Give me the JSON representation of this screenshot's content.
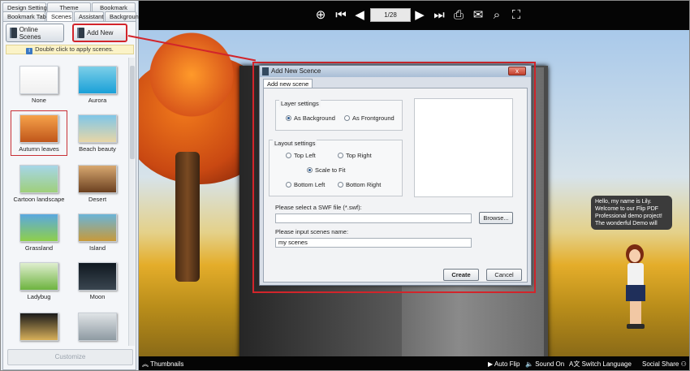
{
  "panel_tabs_row1": [
    "Design Setting",
    "Theme",
    "Bookmark"
  ],
  "panel_tabs_row2": [
    "Bookmark Tabs",
    "Scenes",
    "Assistant",
    "Background"
  ],
  "buttons": {
    "online_scenes": "Online Scenes",
    "add_new": "Add New",
    "customize": "Customize"
  },
  "hint": "Double click to apply scenes.",
  "scenes": [
    {
      "label": "None",
      "colors": [
        "#ffffff",
        "#f0f0f0"
      ]
    },
    {
      "label": "Aurora",
      "colors": [
        "#7ccfe8",
        "#1aa0d8"
      ]
    },
    {
      "label": "Autumn leaves",
      "colors": [
        "#f6a24a",
        "#c0561a"
      ],
      "selected": true
    },
    {
      "label": "Beach beauty",
      "colors": [
        "#7fc6e8",
        "#e8d6a6"
      ]
    },
    {
      "label": "Cartoon landscape",
      "colors": [
        "#a6d6e8",
        "#9fcf7a"
      ]
    },
    {
      "label": "Desert",
      "colors": [
        "#d8a870",
        "#6b4020"
      ]
    },
    {
      "label": "Grassland",
      "colors": [
        "#5aa8e0",
        "#8fcf4a"
      ]
    },
    {
      "label": "Island",
      "colors": [
        "#6ab4d8",
        "#c89a3a"
      ]
    },
    {
      "label": "Ladybug",
      "colors": [
        "#dfeecf",
        "#6db33f"
      ]
    },
    {
      "label": "Moon",
      "colors": [
        "#101820",
        "#3a4650"
      ]
    },
    {
      "label": "",
      "colors": [
        "#1a1a1a",
        "#d8b05a"
      ]
    },
    {
      "label": "",
      "colors": [
        "#dfe3e6",
        "#8e9aa2"
      ]
    }
  ],
  "toolbar": {
    "page": "1/28"
  },
  "dialog": {
    "title": "Add New Scence",
    "close": "x",
    "tab": "Add new scene",
    "layer_settings": "Layer settings",
    "as_background": "As Background",
    "as_frontground": "As Frontground",
    "layout_settings": "Layout settings",
    "top_left": "Top Left",
    "top_right": "Top Right",
    "scale_to_fit": "Scale to Fit",
    "bottom_left": "Bottom Left",
    "bottom_right": "Bottom Right",
    "swf_label": "Please select  a  SWF file (*.swf):",
    "swf_value": "",
    "browse": "Browse...",
    "name_label": "Please input scenes name:",
    "name_value": "my scenes",
    "create": "Create",
    "cancel": "Cancel"
  },
  "bubble": "Hello, my name is Lily. Welcome to our Flip PDF Professional demo project! The wonderful Demo will",
  "bottom": {
    "thumbnails": "Thumbnails",
    "auto_flip": "Auto Flip",
    "sound_on": "Sound On",
    "switch_language": "Switch Language",
    "social_share": "Social Share"
  }
}
